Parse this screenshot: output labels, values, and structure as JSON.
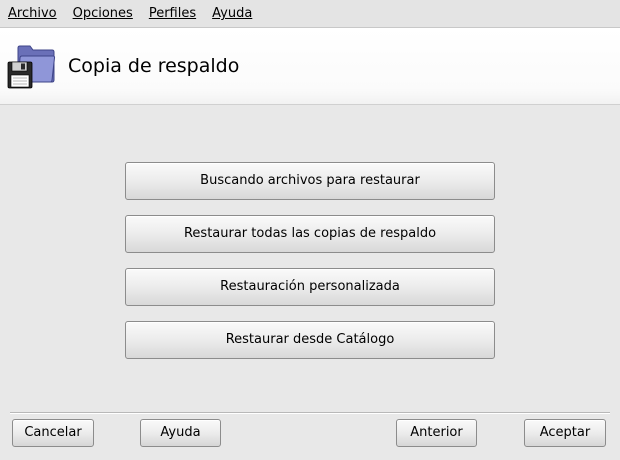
{
  "menubar": {
    "items": [
      {
        "label": "Archivo"
      },
      {
        "label": "Opciones"
      },
      {
        "label": "Perfiles"
      },
      {
        "label": "Ayuda"
      }
    ]
  },
  "header": {
    "title": "Copia de respaldo",
    "icon": "backup-floppy-folder-icon"
  },
  "actions": [
    {
      "label": "Buscando archivos para restaurar"
    },
    {
      "label": "Restaurar todas las copias de respaldo"
    },
    {
      "label": "Restauración personalizada"
    },
    {
      "label": "Restaurar desde Catálogo"
    }
  ],
  "footer": {
    "cancel_label": "Cancelar",
    "help_label": "Ayuda",
    "previous_label": "Anterior",
    "accept_label": "Aceptar"
  },
  "colors": {
    "background": "#e8e8e8",
    "header_background": "#ffffff",
    "folder_blue": "#7f86c8",
    "floppy_dark": "#2a2a2a"
  }
}
